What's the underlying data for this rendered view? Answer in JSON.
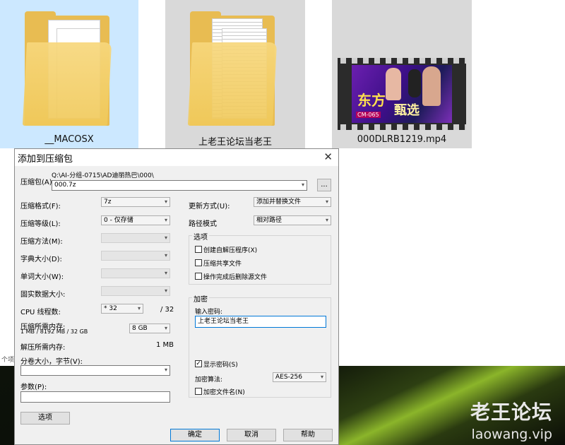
{
  "explorer": {
    "tiles": [
      {
        "label": "__MACOSX"
      },
      {
        "label": "上老王论坛当老王"
      },
      {
        "label": "000DLRB1219.mp4"
      }
    ],
    "partial_text": "个项",
    "video_overlay": [
      "东方",
      "甄选",
      "CM-065"
    ]
  },
  "watermark": {
    "title": "老王论坛",
    "url": "laowang.vip"
  },
  "dialog": {
    "title": "添加到压缩包",
    "close": "✕",
    "archive_label": "压缩包(A)",
    "archive_path": "Q:\\AI-分组-0715\\AD迪丽热巴\\000\\",
    "archive_name": "000.7z",
    "browse": "...",
    "format_label": "压缩格式(F):",
    "format_value": "7z",
    "level_label": "压缩等级(L):",
    "level_value": "0 - 仅存储",
    "method_label": "压缩方法(M):",
    "dict_label": "字典大小(D):",
    "word_label": "单词大小(W):",
    "solid_label": "固实数据大小:",
    "cpu_label": "CPU 线程数:",
    "cpu_value": "* 32",
    "cpu_max": "/ 32",
    "mem_label": "压缩所需内存:",
    "mem_sub": "1 MB / 8192 MB / 32 GB",
    "mem_value": "8 GB",
    "decomp_label": "解压所需内存:",
    "decomp_value": "1 MB",
    "split_label": "分卷大小，字节(V):",
    "params_label": "参数(P):",
    "options_button": "选项",
    "update_label": "更新方式(U):",
    "update_value": "添加并替换文件",
    "pathmode_label": "路径模式",
    "pathmode_value": "相对路径",
    "options_group": "选项",
    "opt_sfx": "创建自解压程序(X)",
    "opt_shared": "压缩共享文件",
    "opt_delete": "操作完成后删除源文件",
    "encrypt_group": "加密",
    "pwd_label": "输入密码:",
    "pwd_value": "上老王论坛当老王",
    "show_pwd": "显示密码(S)",
    "enc_method_label": "加密算法:",
    "enc_method_value": "AES-256",
    "enc_names": "加密文件名(N)",
    "ok": "确定",
    "cancel": "取消",
    "help": "帮助"
  }
}
